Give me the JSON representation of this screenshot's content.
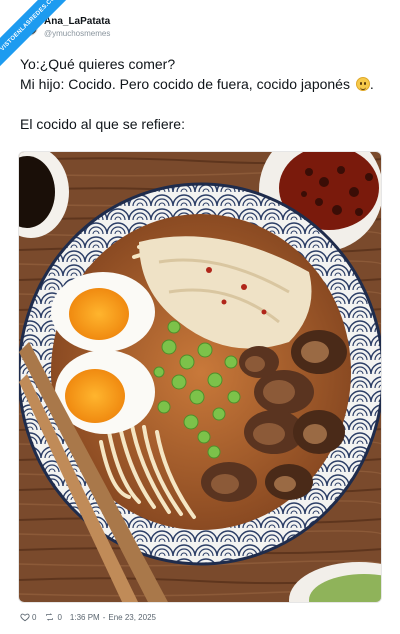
{
  "watermark": {
    "text": "VISTOENLASREDES.COM"
  },
  "header": {
    "display_name": "Ana_LaPatata",
    "handle": "@ymuchosmemes"
  },
  "tweet": {
    "line1": "Yo:¿Qué quieres comer?",
    "line2": "Mi hijo: Cocido. Pero cocido de fuera, cocido japonés",
    "line2_end": ".",
    "line3": "El cocido al que se refiere:"
  },
  "media": {
    "subject": "ramen bowl with eggs, green onions, chicken, mushrooms and chopsticks"
  },
  "footer": {
    "likes": "0",
    "retweets": "0",
    "time": "1:36 PM",
    "separator": "-",
    "date": "Ene 23, 2025"
  },
  "icons": {
    "like": "heart-icon",
    "retweet": "retweet-icon",
    "emoji": "smiley-emoji-icon"
  },
  "colors": {
    "accent": "#1d9bf0",
    "text": "#0f1419",
    "muted": "#5b6670"
  }
}
